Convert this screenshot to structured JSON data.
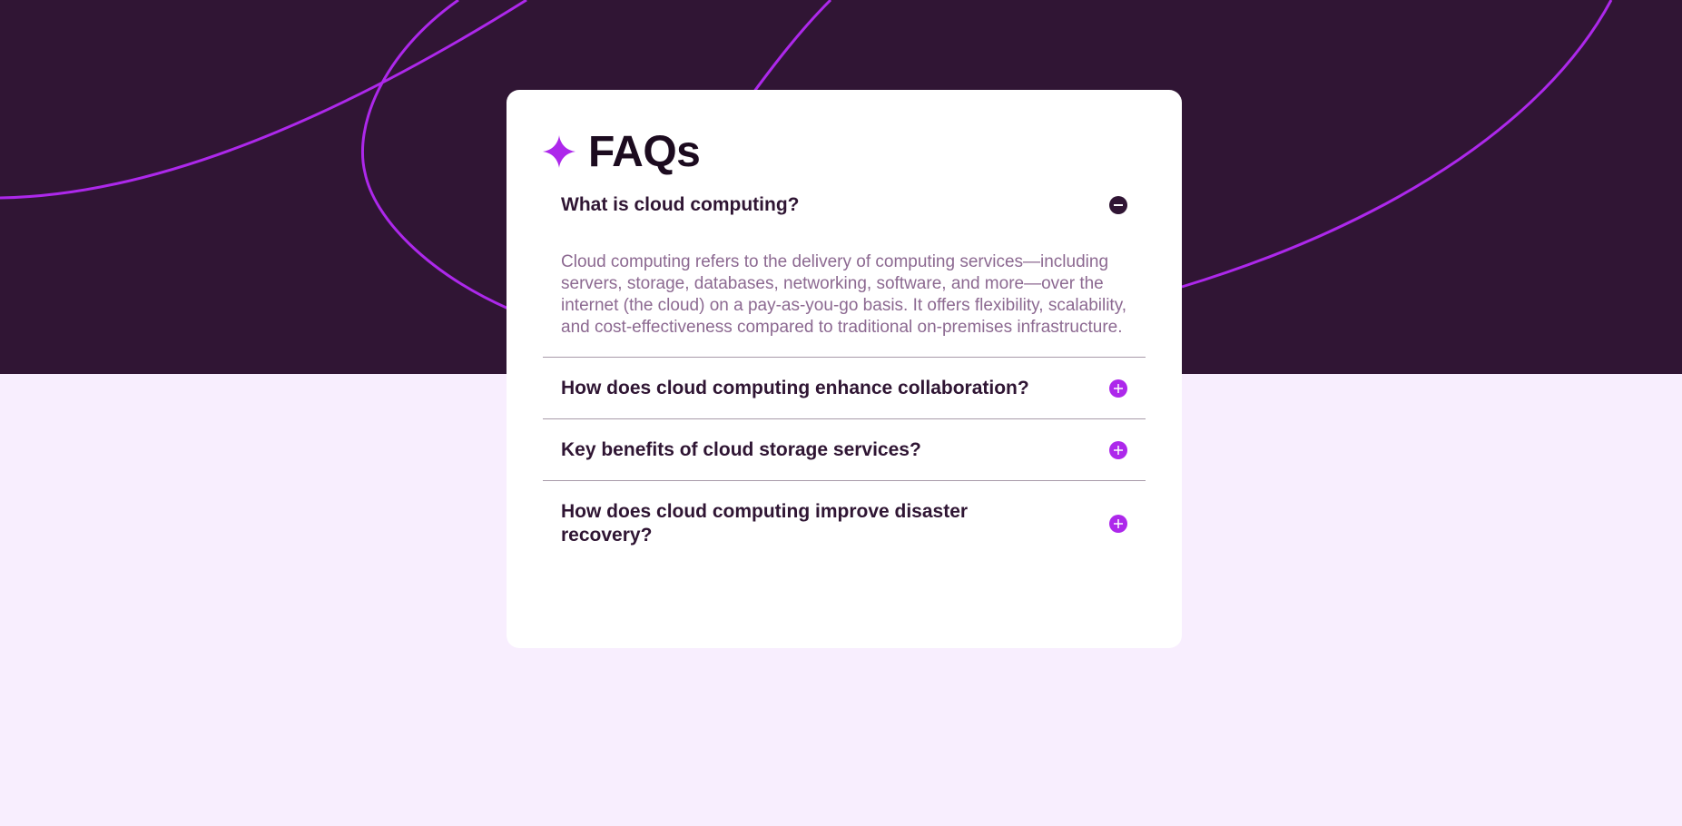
{
  "colors": {
    "hero_bg": "#301534",
    "page_bg": "#f8eefe",
    "accent": "#ad28eb",
    "heading": "#1c0b1f",
    "question": "#2f1533",
    "answer": "#8c6991"
  },
  "header": {
    "title": "FAQs",
    "icon": "star-icon"
  },
  "faqs": [
    {
      "question": "What is cloud computing?",
      "answer": "Cloud computing refers to the delivery of computing services—including servers, storage, databases, networking, software, and more—over the internet (the cloud) on a pay-as-you-go basis. It offers flexibility, scalability, and cost-effectiveness compared to traditional on-premises infrastructure.",
      "expanded": true,
      "icon": "minus-icon"
    },
    {
      "question": "How does cloud computing enhance collaboration?",
      "expanded": false,
      "icon": "plus-icon"
    },
    {
      "question": "Key benefits of cloud storage services?",
      "expanded": false,
      "icon": "plus-icon"
    },
    {
      "question": "How does cloud computing improve disaster recovery?",
      "expanded": false,
      "icon": "plus-icon"
    }
  ]
}
